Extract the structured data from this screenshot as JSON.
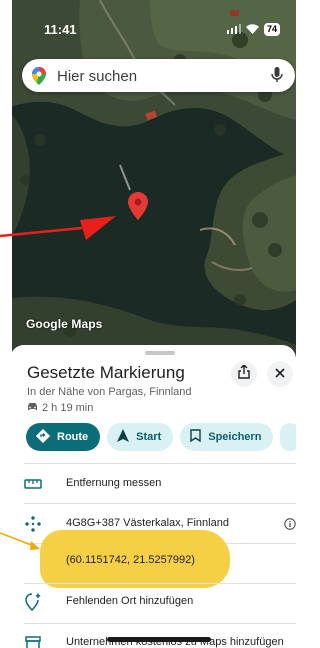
{
  "status_bar": {
    "time": "11:41",
    "battery": "74"
  },
  "search": {
    "placeholder": "Hier suchen"
  },
  "map": {
    "watermark": "Google Maps"
  },
  "place": {
    "title": "Gesetzte Markierung",
    "subtitle": "In der Nähe von Pargas, Finnland",
    "drive_time": "2 h 19 min"
  },
  "actions": [
    {
      "label": "Route",
      "icon": "directions-icon"
    },
    {
      "label": "Start",
      "icon": "navigation-arrow-icon"
    },
    {
      "label": "Speichern",
      "icon": "bookmark-icon"
    }
  ],
  "details": {
    "measure": "Entfernung messen",
    "plus_code": "4G8G+387 Västerkalax, Finnland",
    "coordinates": "(60.1151742, 21.5257992)",
    "add_place": "Fehlenden Ort hinzufügen",
    "add_business": "Unternehmen kostenlos zu Maps hinzufügen"
  },
  "colors": {
    "accent_teal": "#0b6d79",
    "chip_light": "#d9f1f4",
    "pin_red": "#e53935",
    "highlight_yellow": "#f4cc3a",
    "annotation_red": "#e8201c",
    "annotation_orange": "#f2a800"
  }
}
